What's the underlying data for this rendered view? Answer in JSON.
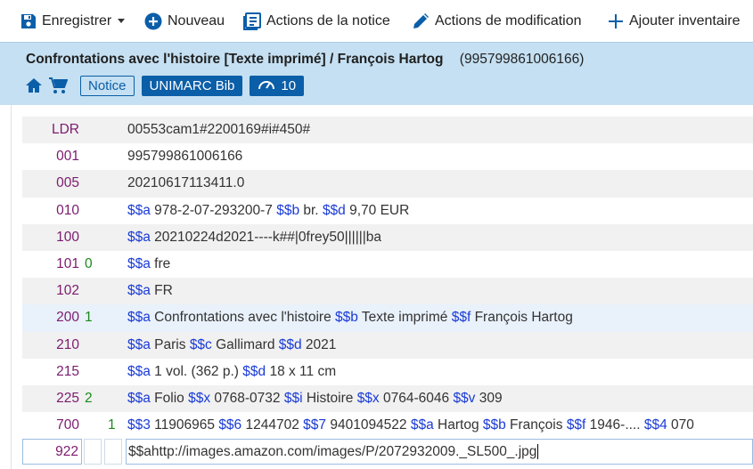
{
  "toolbar": {
    "save_label": "Enregistrer",
    "new_label": "Nouveau",
    "record_actions_label": "Actions de la notice",
    "edit_actions_label": "Actions de modification",
    "add_inventory_label": "Ajouter inventaire"
  },
  "record": {
    "title": "Confrontations avec l'histoire [Texte imprimé] / François Hartog",
    "mms_id": "(995799861006166)",
    "badges": {
      "notice": "Notice",
      "format": "UNIMARC Bib",
      "score": "10"
    }
  },
  "colors": {
    "header_bg": "#c5e0f2",
    "accent": "#0b5ea8",
    "tag": "#7b1b6e",
    "indicator": "#1a8a1a",
    "subfield_code": "#1a3bd6"
  },
  "fields": [
    {
      "tag": "LDR",
      "ind1": "",
      "ind2": "",
      "parts": [
        {
          "t": "text",
          "v": "00553cam1#2200169#i#450#"
        }
      ]
    },
    {
      "tag": "001",
      "ind1": "",
      "ind2": "",
      "parts": [
        {
          "t": "text",
          "v": "995799861006166"
        }
      ]
    },
    {
      "tag": "005",
      "ind1": "",
      "ind2": "",
      "parts": [
        {
          "t": "text",
          "v": "20210617113411.0"
        }
      ]
    },
    {
      "tag": "010",
      "ind1": "",
      "ind2": "",
      "parts": [
        {
          "t": "sf",
          "v": "$$a"
        },
        {
          "t": "text",
          "v": " 978-2-07-293200-7 "
        },
        {
          "t": "sf",
          "v": "$$b"
        },
        {
          "t": "text",
          "v": " br. "
        },
        {
          "t": "sf",
          "v": "$$d"
        },
        {
          "t": "text",
          "v": " 9,70 EUR"
        }
      ]
    },
    {
      "tag": "100",
      "ind1": "",
      "ind2": "",
      "parts": [
        {
          "t": "sf",
          "v": "$$a"
        },
        {
          "t": "text",
          "v": " 20210224d2021----k##|0frey50||||||ba"
        }
      ]
    },
    {
      "tag": "101",
      "ind1": "0",
      "ind2": "",
      "parts": [
        {
          "t": "sf",
          "v": "$$a"
        },
        {
          "t": "text",
          "v": " fre"
        }
      ]
    },
    {
      "tag": "102",
      "ind1": "",
      "ind2": "",
      "parts": [
        {
          "t": "sf",
          "v": "$$a"
        },
        {
          "t": "text",
          "v": " FR"
        }
      ]
    },
    {
      "tag": "200",
      "ind1": "1",
      "ind2": "",
      "parts": [
        {
          "t": "sf",
          "v": "$$a"
        },
        {
          "t": "text",
          "v": " Confrontations avec l'histoire "
        },
        {
          "t": "sf",
          "v": "$$b"
        },
        {
          "t": "text",
          "v": " Texte imprimé "
        },
        {
          "t": "sf",
          "v": "$$f"
        },
        {
          "t": "text",
          "v": " François Hartog"
        }
      ]
    },
    {
      "tag": "210",
      "ind1": "",
      "ind2": "",
      "parts": [
        {
          "t": "sf",
          "v": "$$a"
        },
        {
          "t": "text",
          "v": " Paris "
        },
        {
          "t": "sf",
          "v": "$$c"
        },
        {
          "t": "text",
          "v": " Gallimard "
        },
        {
          "t": "sf",
          "v": "$$d"
        },
        {
          "t": "text",
          "v": " 2021"
        }
      ]
    },
    {
      "tag": "215",
      "ind1": "",
      "ind2": "",
      "parts": [
        {
          "t": "sf",
          "v": "$$a"
        },
        {
          "t": "text",
          "v": " 1 vol. (362 p.) "
        },
        {
          "t": "sf",
          "v": "$$d"
        },
        {
          "t": "text",
          "v": " 18 x 11 cm"
        }
      ]
    },
    {
      "tag": "225",
      "ind1": "2",
      "ind2": "",
      "parts": [
        {
          "t": "sf",
          "v": "$$a"
        },
        {
          "t": "text",
          "v": " Folio "
        },
        {
          "t": "sf",
          "v": "$$x"
        },
        {
          "t": "text",
          "v": " 0768-0732 "
        },
        {
          "t": "sf",
          "v": "$$i"
        },
        {
          "t": "text",
          "v": " Histoire "
        },
        {
          "t": "sf",
          "v": "$$x"
        },
        {
          "t": "text",
          "v": " 0764-6046 "
        },
        {
          "t": "sf",
          "v": "$$v"
        },
        {
          "t": "text",
          "v": " 309"
        }
      ]
    },
    {
      "tag": "700",
      "ind1": "",
      "ind2": "1",
      "parts": [
        {
          "t": "sf",
          "v": "$$3"
        },
        {
          "t": "text",
          "v": " 11906965 "
        },
        {
          "t": "sf",
          "v": "$$6"
        },
        {
          "t": "text",
          "v": " 1244702 "
        },
        {
          "t": "sf",
          "v": "$$7"
        },
        {
          "t": "text",
          "v": " 9401094522 "
        },
        {
          "t": "sf",
          "v": "$$a"
        },
        {
          "t": "text",
          "v": " Hartog "
        },
        {
          "t": "sf",
          "v": "$$b"
        },
        {
          "t": "text",
          "v": " François "
        },
        {
          "t": "sf",
          "v": "$$f"
        },
        {
          "t": "text",
          "v": " 1946-.... "
        },
        {
          "t": "sf",
          "v": "$$4"
        },
        {
          "t": "text",
          "v": " 070"
        }
      ]
    }
  ],
  "editing_field": {
    "tag": "922",
    "ind1": "",
    "ind2": "",
    "value": "$$ahttp://images.amazon.com/images/P/2072932009._SL500_.jpg"
  }
}
